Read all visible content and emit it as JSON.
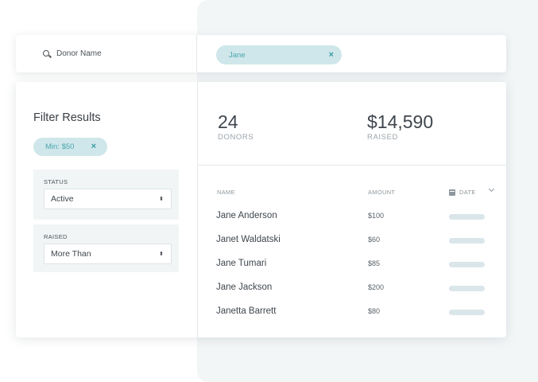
{
  "search": {
    "label": "Donor Name",
    "chip": "Jane",
    "chip_remove": "×"
  },
  "filters": {
    "title": "Filter Results",
    "min_chip": "Min: $50",
    "min_chip_remove": "×",
    "status": {
      "label": "STATUS",
      "value": "Active"
    },
    "raised": {
      "label": "RAISED",
      "value": "More Than"
    },
    "select_arrows": "⬍"
  },
  "stats": {
    "donors": {
      "value": "24",
      "label": "DONORS"
    },
    "raised": {
      "value": "$14,590",
      "label": "RAISED"
    }
  },
  "table": {
    "headers": {
      "name": "NAME",
      "amount": "AMOUNT",
      "date": "DATE"
    },
    "rows": [
      {
        "name": "Jane Anderson",
        "amount": "$100"
      },
      {
        "name": "Janet Waldatski",
        "amount": "$60"
      },
      {
        "name": "Jane Tumari",
        "amount": "$85"
      },
      {
        "name": "Jane Jackson",
        "amount": "$200"
      },
      {
        "name": "Janetta Barrett",
        "amount": "$80"
      }
    ]
  },
  "colors": {
    "chip_bg": "#cfe7ea",
    "chip_text": "#4aa5ad",
    "panel_bg": "#f3f6f7",
    "date_placeholder": "#dae6ea"
  }
}
